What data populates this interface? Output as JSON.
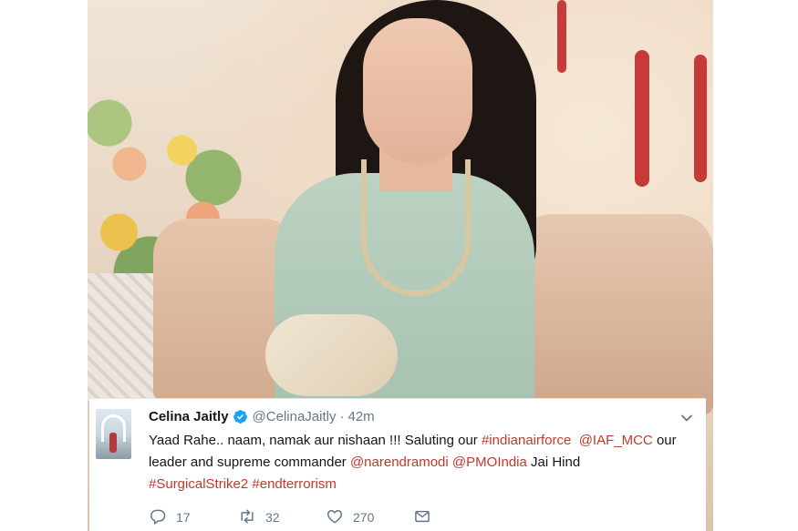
{
  "photo": {
    "description_icon": "event-photo"
  },
  "tweet": {
    "display_name": "Celina Jaitly",
    "handle": "@CelinaJaitly",
    "separator": "·",
    "time": "42m",
    "verified_icon": "verified-badge-icon",
    "verified_color": "#1da1f2",
    "text_segments": {
      "s1": "Yaad Rahe.. naam, namak aur nishaan !!! Saluting our ",
      "tag_indianairforce": "#indianairforce",
      "s2": "  ",
      "mention_iaf": "@IAF_MCC",
      "s3": " our leader and supreme commander ",
      "mention_modi": "@narendramodi",
      "s4": " ",
      "mention_pmo": "@PMOIndia",
      "s5": " Jai Hind ",
      "tag_surgical": "#SurgicalStrike2",
      "s6": " ",
      "tag_endterrorism": "#endterrorism"
    },
    "link_color": "#c0392b",
    "actions": {
      "reply_count": "17",
      "retweet_count": "32",
      "like_count": "270"
    }
  }
}
